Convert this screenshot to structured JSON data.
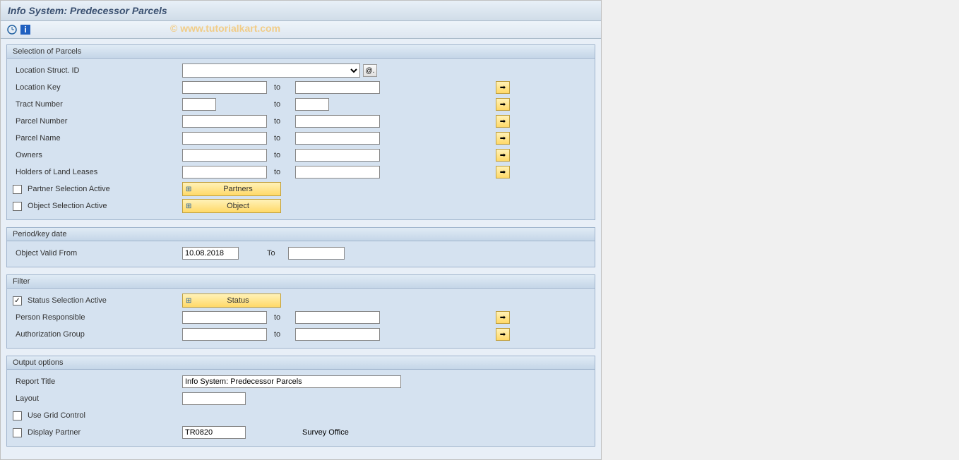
{
  "title": "Info System: Predecessor Parcels",
  "watermark": "© www.tutorialkart.com",
  "groups": {
    "selection": {
      "header": "Selection of Parcels",
      "locationStructId": {
        "label": "Location Struct. ID"
      },
      "locationKey": {
        "label": "Location Key",
        "to": "to"
      },
      "tractNumber": {
        "label": "Tract Number",
        "to": "to"
      },
      "parcelNumber": {
        "label": "Parcel Number",
        "to": "to"
      },
      "parcelName": {
        "label": "Parcel Name",
        "to": "to"
      },
      "owners": {
        "label": "Owners",
        "to": "to"
      },
      "holders": {
        "label": "Holders of Land Leases",
        "to": "to"
      },
      "partnerActive": {
        "label": "Partner Selection Active",
        "button": "Partners"
      },
      "objectActive": {
        "label": "Object Selection Active",
        "button": "Object"
      }
    },
    "period": {
      "header": "Period/key date",
      "validFrom": {
        "label": "Object Valid From",
        "value": "10.08.2018",
        "to": "To"
      }
    },
    "filter": {
      "header": "Filter",
      "statusActive": {
        "label": "Status Selection Active",
        "button": "Status",
        "checked": "✓"
      },
      "personResp": {
        "label": "Person Responsible",
        "to": "to"
      },
      "authGroup": {
        "label": "Authorization Group",
        "to": "to"
      }
    },
    "output": {
      "header": "Output options",
      "reportTitle": {
        "label": "Report Title",
        "value": "Info System: Predecessor Parcels"
      },
      "layout": {
        "label": "Layout"
      },
      "useGrid": {
        "label": "Use Grid Control"
      },
      "displayPartner": {
        "label": "Display Partner",
        "code": "TR0820",
        "desc": "Survey Office"
      }
    }
  },
  "icons": {
    "arrow": "➡",
    "at": "@."
  }
}
